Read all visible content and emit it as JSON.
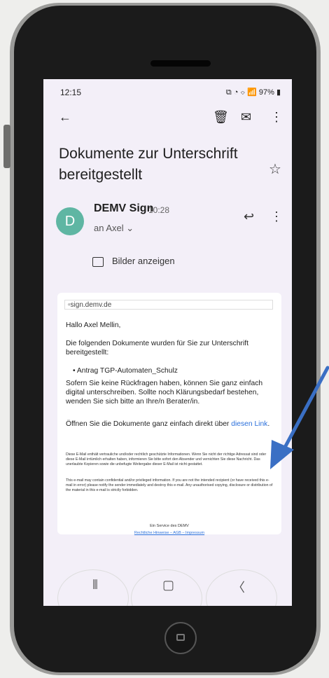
{
  "status": {
    "time": "12:15",
    "battery": "97%"
  },
  "email": {
    "subject": "Dokumente zur Unterschrift bereitgestellt",
    "sender_initial": "D",
    "sender": "DEMV Sign",
    "time": "10:28",
    "recipient": "an Axel ⌄",
    "show_images": "Bilder anzeigen"
  },
  "body": {
    "image_alt": "sign.demv.de",
    "greeting": "Hallo Axel Mellin,",
    "intro": "Die folgenden Dokumente wurden für Sie zur Unterschrift bereitgestellt:",
    "document": "Antrag TGP-Automaten_Schulz",
    "info": "Sofern Sie keine Rückfragen haben, können Sie ganz einfach digital unterschreiben. Sollte noch Klärungsbedarf bestehen, wenden Sie sich bitte an Ihre/n Berater/in.",
    "open_text": "Öffnen Sie die Dokumente ganz einfach direkt über",
    "link": "diesen Link",
    "period": ".",
    "disclaimer_de": "Diese E-Mail enthält vertrauliche und/oder rechtlich geschützte Informationen. Wenn Sie nicht der richtige Adressat sind oder diese E-Mail irrtümlich erhalten haben, informieren Sie bitte sofort den Absender und vernichten Sie diese Nachricht. Das unerlaubte Kopieren sowie die unbefugte Weitergabe dieser E-Mail ist nicht gestattet.",
    "disclaimer_en": "This e-mail may contain confidential and/or privileged information. If you are not the intended recipient (or have received this e-mail in error) please notify the sender immediately and destroy this e-mail. Any unauthorised copying, disclosure or distribution of the material in this e-mail is strictly forbidden.",
    "footer_service": "Ein Service des DEMV",
    "footer_links": "Rechtliche Hinweise – AGB – Impressum"
  },
  "colors": {
    "accent": "#2a6fdb",
    "avatar": "#5fb6a3",
    "arrow": "#3a6fc4"
  }
}
